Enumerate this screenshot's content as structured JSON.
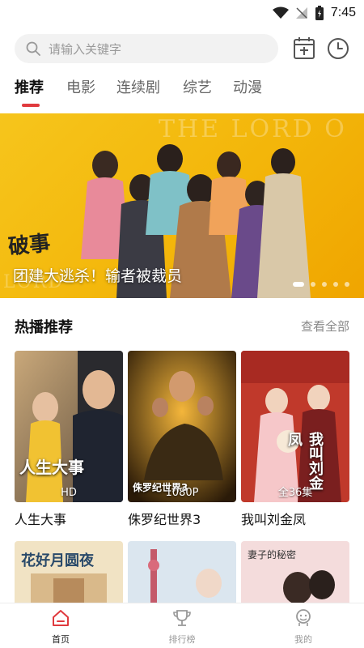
{
  "status_bar": {
    "time": "7:45"
  },
  "search": {
    "placeholder": "请输入关键字"
  },
  "tabs": [
    {
      "label": "推荐",
      "active": true
    },
    {
      "label": "电影",
      "active": false
    },
    {
      "label": "连续剧",
      "active": false
    },
    {
      "label": "综艺",
      "active": false
    },
    {
      "label": "动漫",
      "active": false
    }
  ],
  "banner": {
    "background_text": "THE LORD O",
    "background_text2": "LORD",
    "logo_text": "破事",
    "caption": "团建大逃杀！输者被裁员",
    "slide_count": 5,
    "active_slide": 0
  },
  "section": {
    "title": "热播推荐",
    "more_label": "查看全部"
  },
  "posters": [
    {
      "title": "人生大事",
      "badge": "HD",
      "overlay_text": "人生大事"
    },
    {
      "title": "侏罗纪世界3",
      "badge": "1080P",
      "overlay_text": "侏罗纪世界3"
    },
    {
      "title": "我叫刘金凤",
      "badge": "全36集",
      "overlay_text": "我叫刘金凤"
    }
  ],
  "posters_row2": [
    {
      "overlay_text": "花好月圆夜"
    },
    {
      "overlay_text": ""
    },
    {
      "overlay_text": "妻子的秘密"
    }
  ],
  "bottom_nav": [
    {
      "label": "首页",
      "icon": "home-icon",
      "active": true
    },
    {
      "label": "排行榜",
      "icon": "trophy-icon",
      "active": false
    },
    {
      "label": "我的",
      "icon": "profile-icon",
      "active": false
    }
  ],
  "colors": {
    "accent": "#e03a3e",
    "banner_yellow": "#f6c51c"
  }
}
